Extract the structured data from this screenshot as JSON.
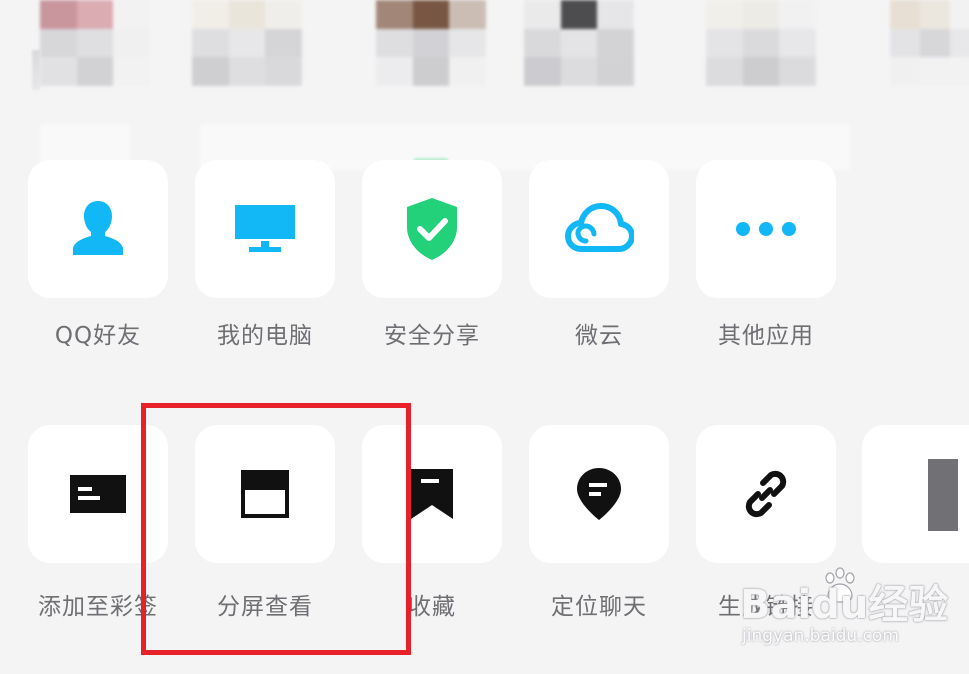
{
  "share_targets": [
    {
      "id": "qq-friend",
      "label": "QQ好友",
      "icon": "person-icon",
      "color": "#12b7f5"
    },
    {
      "id": "my-computer",
      "label": "我的电脑",
      "icon": "monitor-icon",
      "color": "#12b7f5"
    },
    {
      "id": "secure-share",
      "label": "安全分享",
      "icon": "shield-check-icon",
      "color": "#22d17a"
    },
    {
      "id": "weiyun",
      "label": "微云",
      "icon": "cloud-icon",
      "color": "#12b7f5"
    },
    {
      "id": "other-apps",
      "label": "其他应用",
      "icon": "more-dots-icon",
      "color": "#12b7f5"
    }
  ],
  "actions": [
    {
      "id": "add-to-sticker",
      "label": "添加至彩签",
      "icon": "card-icon"
    },
    {
      "id": "split-screen",
      "label": "分屏查看",
      "icon": "split-window-icon"
    },
    {
      "id": "favorite",
      "label": "收藏",
      "icon": "bookmark-icon"
    },
    {
      "id": "locate-chat",
      "label": "定位聊天",
      "icon": "location-pin-icon"
    },
    {
      "id": "generate-link",
      "label": "生成链接",
      "icon": "link-icon"
    }
  ],
  "watermark": {
    "main": "Baidu经验",
    "sub": "jingyan.baidu.com"
  },
  "colors": {
    "highlight": "#e8202a",
    "icon_dark": "#111111",
    "label": "#6e6e73"
  }
}
